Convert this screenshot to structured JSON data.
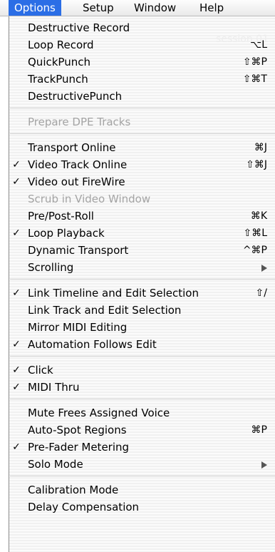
{
  "menubar": {
    "items": [
      "Options",
      "Setup",
      "Window",
      "Help"
    ]
  },
  "background_window": {
    "title_fragment": "session 01"
  },
  "menu": {
    "items": [
      {
        "label": "Destructive Record",
        "shortcut": "",
        "checked": false,
        "disabled": false,
        "submenu": false
      },
      {
        "label": "Loop Record",
        "shortcut": "⌥L",
        "checked": false,
        "disabled": false,
        "submenu": false
      },
      {
        "label": "QuickPunch",
        "shortcut": "⇧⌘P",
        "checked": false,
        "disabled": false,
        "submenu": false
      },
      {
        "label": "TrackPunch",
        "shortcut": "⇧⌘T",
        "checked": false,
        "disabled": false,
        "submenu": false
      },
      {
        "label": "DestructivePunch",
        "shortcut": "",
        "checked": false,
        "disabled": false,
        "submenu": false
      },
      {
        "label": "Prepare DPE Tracks",
        "shortcut": "",
        "checked": false,
        "disabled": true,
        "submenu": false
      },
      {
        "label": "Transport Online",
        "shortcut": "⌘J",
        "checked": false,
        "disabled": false,
        "submenu": false
      },
      {
        "label": "Video Track Online",
        "shortcut": "⇧⌘J",
        "checked": true,
        "disabled": false,
        "submenu": false
      },
      {
        "label": "Video out FireWire",
        "shortcut": "",
        "checked": true,
        "disabled": false,
        "submenu": false
      },
      {
        "label": "Scrub in Video Window",
        "shortcut": "",
        "checked": false,
        "disabled": true,
        "submenu": false
      },
      {
        "label": "Pre/Post-Roll",
        "shortcut": "⌘K",
        "checked": false,
        "disabled": false,
        "submenu": false
      },
      {
        "label": "Loop Playback",
        "shortcut": "⇧⌘L",
        "checked": true,
        "disabled": false,
        "submenu": false
      },
      {
        "label": "Dynamic Transport",
        "shortcut": "^⌘P",
        "checked": false,
        "disabled": false,
        "submenu": false
      },
      {
        "label": "Scrolling",
        "shortcut": "",
        "checked": false,
        "disabled": false,
        "submenu": true
      },
      {
        "label": "Link Timeline and Edit Selection",
        "shortcut": "⇧/",
        "checked": true,
        "disabled": false,
        "submenu": false
      },
      {
        "label": "Link Track and Edit Selection",
        "shortcut": "",
        "checked": false,
        "disabled": false,
        "submenu": false
      },
      {
        "label": "Mirror MIDI Editing",
        "shortcut": "",
        "checked": false,
        "disabled": false,
        "submenu": false
      },
      {
        "label": "Automation Follows Edit",
        "shortcut": "",
        "checked": true,
        "disabled": false,
        "submenu": false
      },
      {
        "label": "Click",
        "shortcut": "",
        "checked": true,
        "disabled": false,
        "submenu": false
      },
      {
        "label": "MIDI Thru",
        "shortcut": "",
        "checked": true,
        "disabled": false,
        "submenu": false
      },
      {
        "label": "Mute Frees Assigned Voice",
        "shortcut": "",
        "checked": false,
        "disabled": false,
        "submenu": false
      },
      {
        "label": "Auto-Spot Regions",
        "shortcut": "⌘P",
        "checked": false,
        "disabled": false,
        "submenu": false
      },
      {
        "label": "Pre-Fader Metering",
        "shortcut": "",
        "checked": true,
        "disabled": false,
        "submenu": false
      },
      {
        "label": "Solo Mode",
        "shortcut": "",
        "checked": false,
        "disabled": false,
        "submenu": true
      },
      {
        "label": "Calibration Mode",
        "shortcut": "",
        "checked": false,
        "disabled": false,
        "submenu": false
      },
      {
        "label": "Delay Compensation",
        "shortcut": "",
        "checked": false,
        "disabled": false,
        "submenu": false
      }
    ]
  },
  "check_glyph": "✓"
}
